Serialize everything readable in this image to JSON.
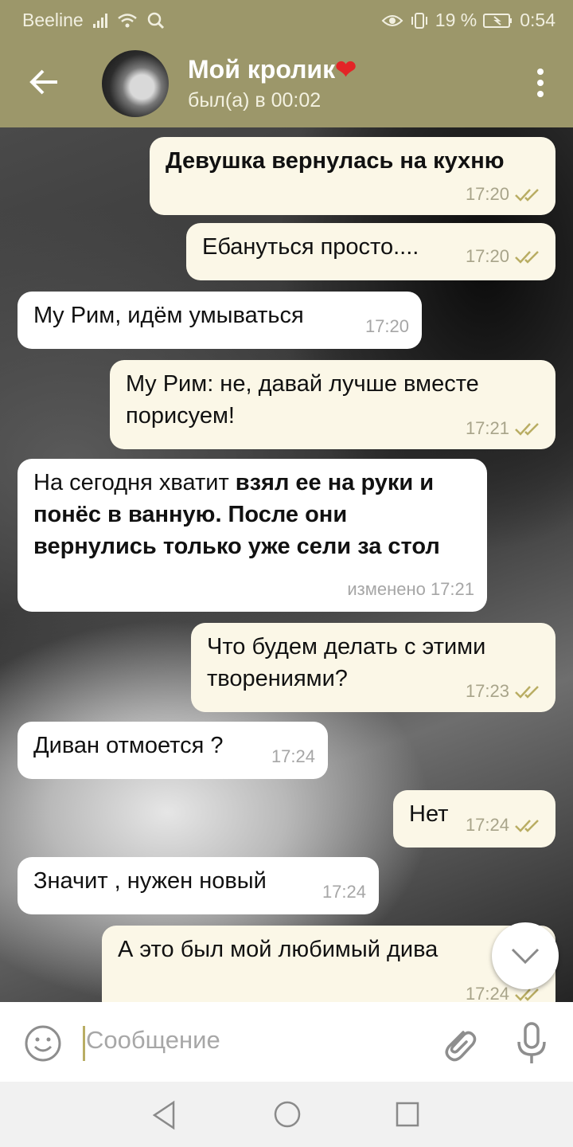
{
  "status_bar": {
    "carrier": "Beeline",
    "battery": "19 %",
    "time": "0:54"
  },
  "header": {
    "title": "Мой кролик",
    "title_emoji": "❤",
    "status": "был(а) в 00:02"
  },
  "messages": [
    {
      "dir": "out",
      "text": "Девушка вернулась на кухню",
      "time": "17:20",
      "read": true
    },
    {
      "dir": "out",
      "text": "Ебануться просто....",
      "time": "17:20",
      "read": true
    },
    {
      "dir": "in",
      "text": "My Рим, идём умываться",
      "time": "17:20"
    },
    {
      "dir": "out",
      "text": "My Рим: не, давай лучше вместе порисуем!",
      "time": "17:21",
      "read": true
    },
    {
      "dir": "in",
      "text_normal": "На сегодня хватит ",
      "text_bold": "взял ее на руки и понёс в ванную. После они вернулись только уже сели за стол",
      "time": "изменено 17:21"
    },
    {
      "dir": "out",
      "text": "Что будем делать с этими творениями?",
      "time": "17:23",
      "read": true
    },
    {
      "dir": "in",
      "text": "Диван отмоется ?",
      "time": "17:24"
    },
    {
      "dir": "out",
      "text": "Нет",
      "time": "17:24",
      "read": true
    },
    {
      "dir": "in",
      "text": "Значит , нужен новый",
      "time": "17:24"
    },
    {
      "dir": "out",
      "text": "А это был мой любимый дива",
      "time": "17:24",
      "read": true
    }
  ],
  "input": {
    "placeholder": "Сообщение"
  },
  "colors": {
    "header_bg": "#9c976a",
    "outgoing_bubble": "#fbf7e7",
    "incoming_bubble": "#ffffff",
    "read_ticks": "#b9ad63"
  },
  "icons": {
    "back": "arrow-left-icon",
    "menu": "more-vert-icon",
    "scroll": "chevron-down-icon",
    "emoji": "smiley-icon",
    "attach": "paperclip-icon",
    "mic": "microphone-icon"
  }
}
